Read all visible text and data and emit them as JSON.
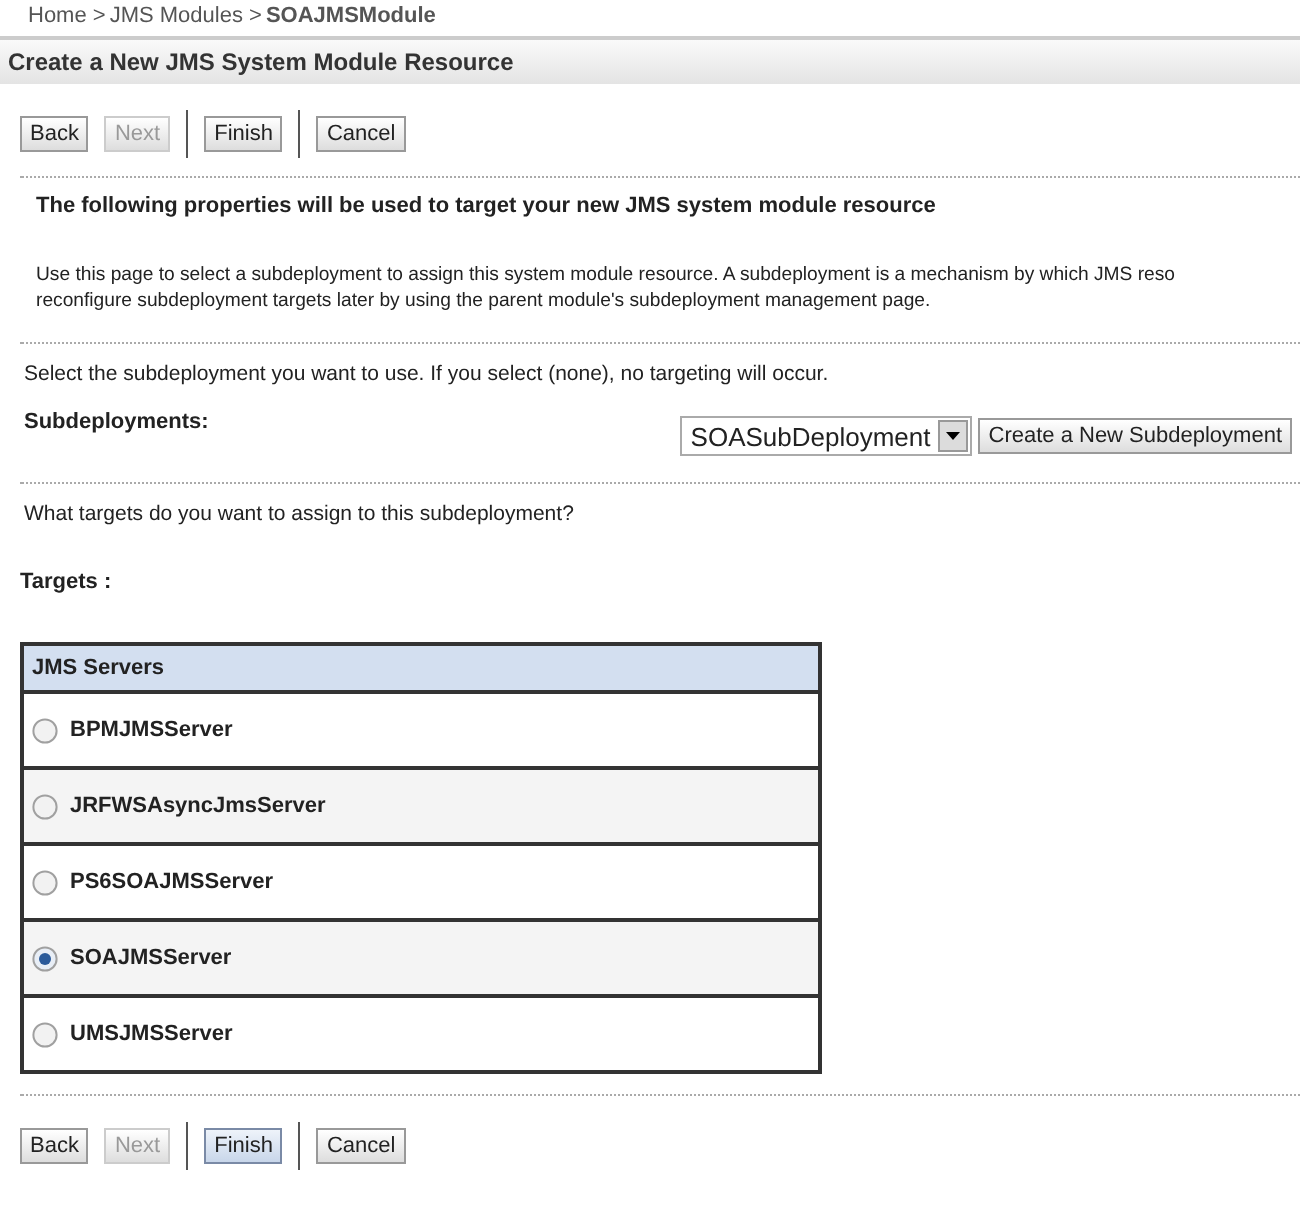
{
  "breadcrumb": [
    {
      "label": "Home >",
      "current": false
    },
    {
      "label": "JMS Modules >",
      "current": false
    },
    {
      "label": "SOAJMSModule",
      "current": true
    }
  ],
  "title": "Create a New JMS System Module Resource",
  "top_buttons": [
    [
      {
        "label": "Back",
        "disabled": false,
        "highlighted": false
      },
      {
        "label": "Next",
        "disabled": true,
        "highlighted": false
      }
    ],
    [
      {
        "label": "Finish",
        "disabled": false,
        "highlighted": false
      }
    ],
    [
      {
        "label": "Cancel",
        "disabled": false,
        "highlighted": false
      }
    ]
  ],
  "heading": "The following properties will be used to target your new JMS system module resource",
  "description_lines": [
    "Use this page to select a subdeployment to assign this system module resource. A subdeployment is a mechanism by which JMS reso",
    "reconfigure subdeployment targets later by using the parent module's subdeployment management page."
  ],
  "select_hint": "Select the subdeployment you want to use. If you select (none), no targeting will occur.",
  "subdeployments": {
    "label": "Subdeployments:",
    "value": "SOASubDeployment",
    "create_button": "Create a New Subdeployment"
  },
  "targets_question": "What targets do you want to assign to this subdeployment?",
  "targets_label": "Targets :",
  "table": {
    "header": "JMS Servers",
    "rows": [
      {
        "label": "BPMJMSServer",
        "selected": false
      },
      {
        "label": "JRFWSAsyncJmsServer",
        "selected": false
      },
      {
        "label": "PS6SOAJMSServer",
        "selected": false
      },
      {
        "label": "SOAJMSServer",
        "selected": true
      },
      {
        "label": "UMSJMSServer",
        "selected": false
      }
    ]
  },
  "bottom_buttons": [
    [
      {
        "label": "Back",
        "disabled": false,
        "highlighted": false
      },
      {
        "label": "Next",
        "disabled": true,
        "highlighted": false
      }
    ],
    [
      {
        "label": "Finish",
        "disabled": false,
        "highlighted": true
      }
    ],
    [
      {
        "label": "Cancel",
        "disabled": false,
        "highlighted": false
      }
    ]
  ]
}
